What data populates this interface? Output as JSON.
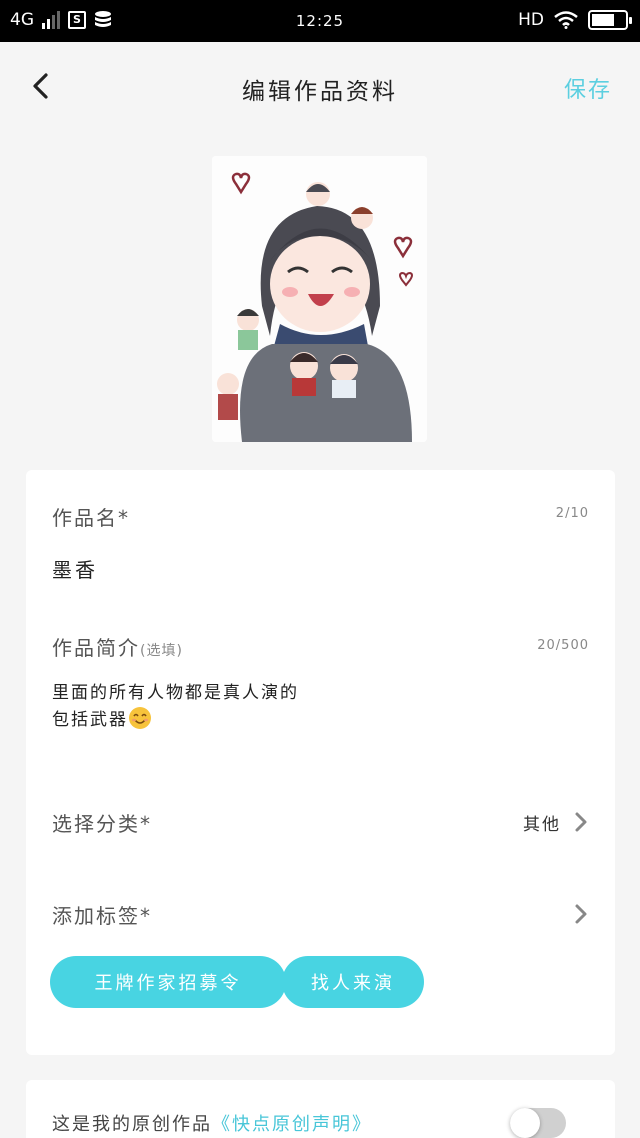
{
  "status_bar": {
    "network": "4G",
    "time": "12:25",
    "hd": "HD"
  },
  "header": {
    "title": "编辑作品资料",
    "save_label": "保存"
  },
  "form": {
    "work_name": {
      "label": "作品名*",
      "counter": "2/10",
      "value": "墨香"
    },
    "intro": {
      "label": "作品简介",
      "hint": "(选填)",
      "counter": "20/500",
      "line1": "里面的所有人物都是真人演的",
      "line2": "包括武器"
    },
    "category": {
      "label": "选择分类*",
      "value": "其他"
    },
    "tags": {
      "label": "添加标签*",
      "chips": [
        "王牌作家招募令",
        "找人来演"
      ]
    }
  },
  "original": {
    "text": "这是我的原创作品",
    "link": "《快点原创声明》",
    "toggle_on": false
  },
  "colors": {
    "accent": "#48d4e2",
    "save": "#5ccfe0"
  },
  "icons": {
    "back": "chevron-left-icon",
    "row_arrow": "chevron-right-icon",
    "emoji": "smiling-face-emoji"
  }
}
